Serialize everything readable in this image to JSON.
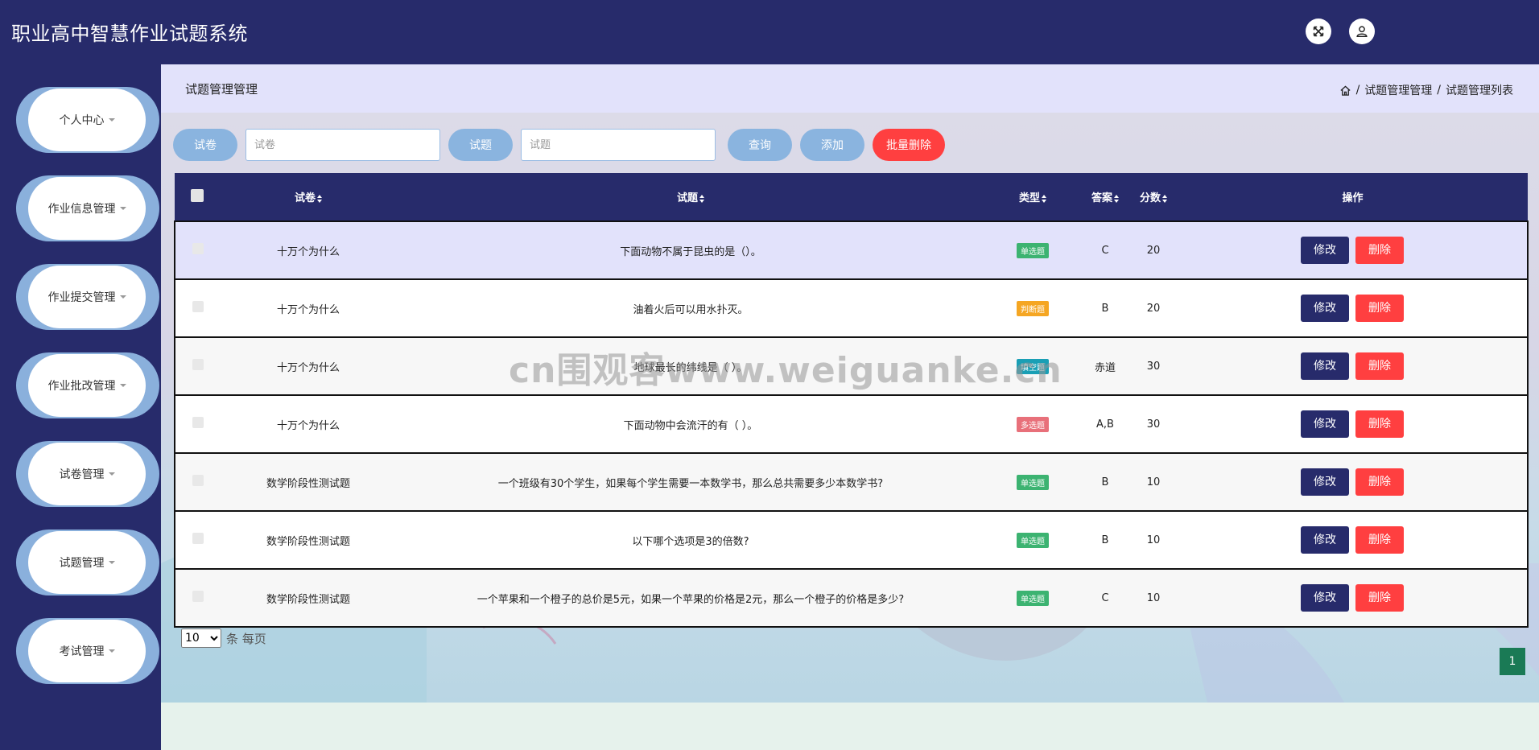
{
  "app": {
    "title": "职业高中智慧作业试题系统",
    "icons": [
      "fullscreen-icon",
      "user-icon"
    ]
  },
  "sidebar": {
    "items": [
      {
        "label": "个人中心"
      },
      {
        "label": "作业信息管理"
      },
      {
        "label": "作业提交管理"
      },
      {
        "label": "作业批改管理"
      },
      {
        "label": "试卷管理"
      },
      {
        "label": "试题管理"
      },
      {
        "label": "考试管理"
      }
    ]
  },
  "breadcrumb": {
    "page_title": "试题管理管理",
    "path": [
      "试题管理管理",
      "试题管理列表"
    ],
    "separator": "/"
  },
  "search": {
    "paper_label": "试卷",
    "paper_placeholder": "试卷",
    "question_label": "试题",
    "question_placeholder": "试题",
    "query_label": "查询",
    "add_label": "添加",
    "batch_delete_label": "批量删除"
  },
  "table": {
    "headers": {
      "paper": "试卷",
      "question": "试题",
      "type": "类型",
      "answer": "答案",
      "score": "分数",
      "actions": "操作"
    },
    "edit_label": "修改",
    "delete_label": "删除",
    "rows": [
      {
        "paper": "十万个为什么",
        "question": "下面动物不属于昆虫的是（）。",
        "type": "单选题",
        "type_color": "#3cb371",
        "answer": "C",
        "score": "20"
      },
      {
        "paper": "十万个为什么",
        "question": "油着火后可以用水扑灭。",
        "type": "判断题",
        "type_color": "#f5a623",
        "answer": "B",
        "score": "20"
      },
      {
        "paper": "十万个为什么",
        "question": "地球最长的纬线是（ ）。",
        "type": "填空题",
        "type_color": "#1a9fb5",
        "answer": "赤道",
        "score": "30"
      },
      {
        "paper": "十万个为什么",
        "question": "下面动物中会流汗的有（ ）。",
        "type": "多选题",
        "type_color": "#e8707a",
        "answer": "A,B",
        "score": "30"
      },
      {
        "paper": "数学阶段性测试题",
        "question": "一个班级有30个学生，如果每个学生需要一本数学书，那么总共需要多少本数学书?",
        "type": "单选题",
        "type_color": "#3cb371",
        "answer": "B",
        "score": "10"
      },
      {
        "paper": "数学阶段性测试题",
        "question": "以下哪个选项是3的倍数?",
        "type": "单选题",
        "type_color": "#3cb371",
        "answer": "B",
        "score": "10"
      },
      {
        "paper": "数学阶段性测试题",
        "question": "一个苹果和一个橙子的总价是5元，如果一个苹果的价格是2元，那么一个橙子的价格是多少?",
        "type": "单选题",
        "type_color": "#3cb371",
        "answer": "C",
        "score": "10"
      }
    ]
  },
  "pagination": {
    "page_size": "10",
    "page_size_suffix": "条 每页",
    "current_page": "1"
  },
  "watermark": "cn围观客www.weiguanke.cn",
  "colors": {
    "primary": "#272b6b",
    "accent": "#8ab4df",
    "danger": "#ff3f40",
    "breadcrumb_bg": "#e2e2fb"
  }
}
